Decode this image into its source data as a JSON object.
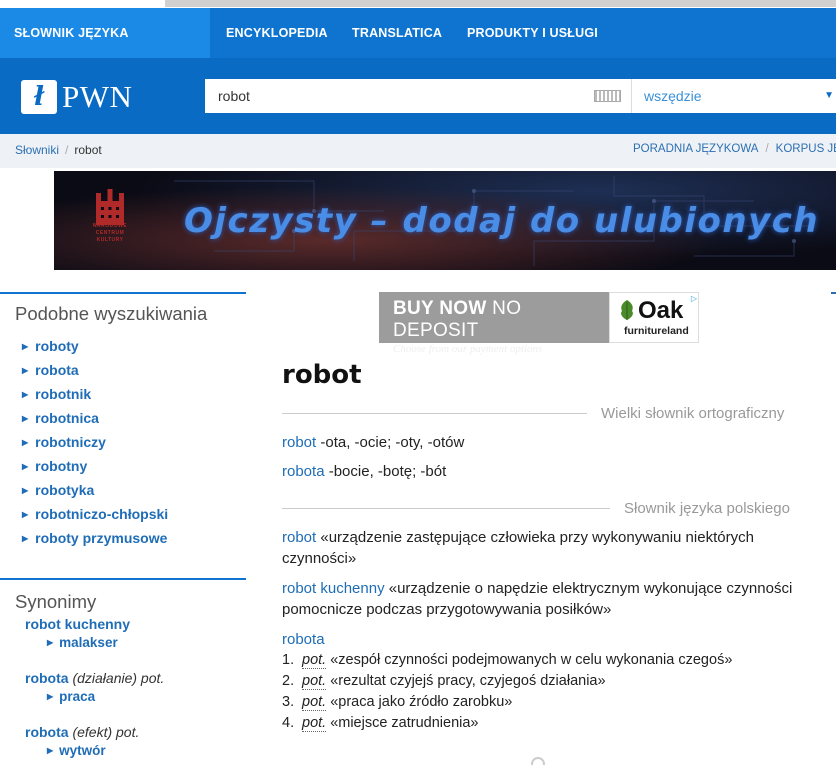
{
  "topnav": {
    "items": [
      "SŁOWNIK JĘZYKA POLSKIEGO",
      "ENCYKLOPEDIA",
      "TRANSLATICA",
      "PRODUKTY I USŁUGI"
    ]
  },
  "header": {
    "logo_text": "PWN",
    "search_value": "robot",
    "scope_value": "wszędzie"
  },
  "breadcrumb": {
    "items": [
      "Słowniki",
      "robot"
    ],
    "right_links": [
      "PORADNIA JĘZYKOWA",
      "KORPUS JĘZYK"
    ]
  },
  "banner": {
    "title": "Ojczysty – dodaj do ulubionych",
    "logo_caption": "NARODOWE CENTRUM KULTURY"
  },
  "ad": {
    "headline_bold": "BUY NOW",
    "headline_light": " NO DEPOSIT",
    "tagline": "Choose from our payment options",
    "brand": "Oak",
    "brand_sub": "furnitureland"
  },
  "sidebar": {
    "similar_title": "Podobne wyszukiwania",
    "similar": [
      "roboty",
      "robota",
      "robotnik",
      "robotnica",
      "robotniczy",
      "robotny",
      "robotyka",
      "robotniczo-chłopski",
      "roboty przymusowe"
    ],
    "synonyms_title": "Synonimy",
    "synonyms": [
      {
        "head": "robot kuchenny",
        "note": "",
        "items": [
          "malakser"
        ]
      },
      {
        "head": "robota",
        "note": " (działanie) pot.",
        "items": [
          "praca"
        ]
      },
      {
        "head": "robota",
        "note": " (efekt) pot.",
        "items": [
          "wytwór"
        ]
      }
    ]
  },
  "main": {
    "title": "robot",
    "section1": {
      "label": "Wielki słownik ortograficzny",
      "entries": [
        {
          "hw": "robot",
          "text": " -ota, -ocie; -oty, -otów"
        },
        {
          "hw": "robota",
          "text": " -bocie, -botę; -bót"
        }
      ]
    },
    "section2": {
      "label": "Słownik języka polskiego",
      "entries": [
        {
          "hw": "robot",
          "text": " «urządzenie zastępujące człowieka przy wykonywaniu niektórych czynności»"
        },
        {
          "hw": "robot kuchenny",
          "text": " «urządzenie o napędzie elektrycznym wykonujące czynności pomocnicze podczas przygotowywania posiłków»"
        }
      ],
      "robota_hw": "robota",
      "robota_senses": [
        {
          "num": "1.",
          "qual": "pot.",
          "text": "«zespół czynności podejmowanych w celu wykonania czegoś»"
        },
        {
          "num": "2.",
          "qual": "pot.",
          "text": "«rezultat czyjejś pracy, czyjegoś działania»"
        },
        {
          "num": "3.",
          "qual": "pot.",
          "text": "«praca jako źródło zarobku»"
        },
        {
          "num": "4.",
          "qual": "pot.",
          "text": "«miejsce zatrudnienia»"
        }
      ]
    }
  },
  "colors": {
    "nav_blue": "#0e74d0",
    "header_blue": "#0a6bc4",
    "link_blue": "#1f6db6"
  }
}
